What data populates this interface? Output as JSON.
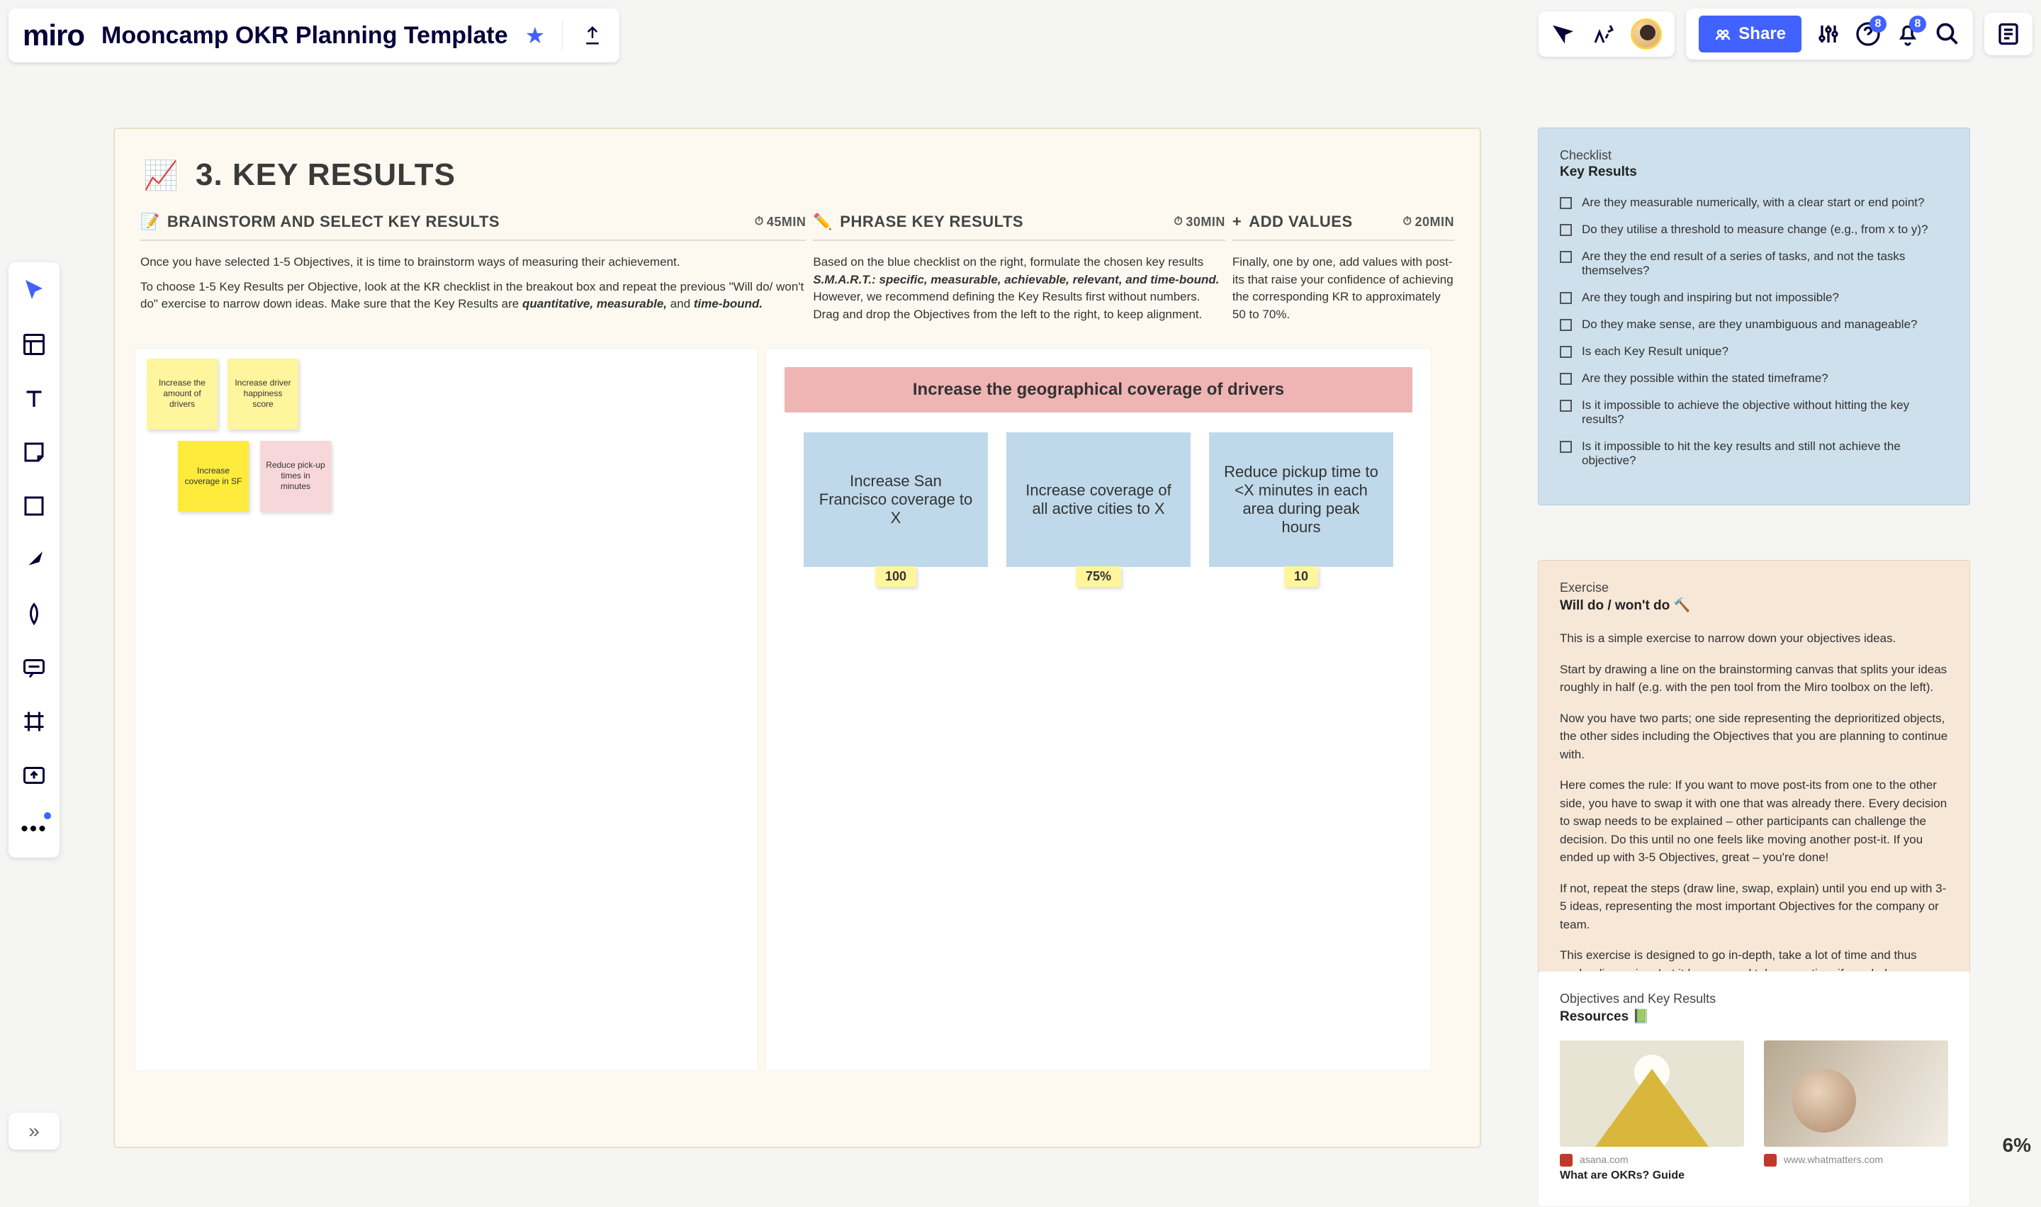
{
  "app": {
    "name": "miro"
  },
  "board": {
    "title": "Mooncamp OKR Planning Template"
  },
  "toolbar": {
    "share_label": "Share",
    "help_badge": "8",
    "bell_badge": "8"
  },
  "zoom": {
    "level": "6%"
  },
  "section": {
    "title_emoji": "📈",
    "title": "3. KEY RESULTS",
    "columns": [
      {
        "emoji": "📝",
        "heading": "BRAINSTORM AND SELECT KEY RESULTS",
        "time": "45min",
        "desc_p1": "Once you have selected 1-5 Objectives, it is time to brainstorm ways of measuring their achievement.",
        "desc_p2_a": "To choose 1-5 Key Results per Objective, look at the KR checklist in the breakout box and repeat the previous \"Will do/ won't do\" exercise to narrow down ideas. Make sure that the Key Results are ",
        "desc_p2_b": "quantitative, measurable,",
        "desc_p2_c": " and ",
        "desc_p2_d": "time-bound."
      },
      {
        "emoji": "✏️",
        "heading": "PHRASE KEY RESULTS",
        "time": "30min",
        "desc_p1_a": "Based on the blue checklist on the right, formulate the chosen key results ",
        "desc_p1_b": "S.M.A.R.T.: specific, measurable, achievable, relevant, and time-bound.",
        "desc_p1_c": " However, we recommend defining the Key Results first without numbers. Drag and drop the Objectives from the left to the right, to keep alignment."
      },
      {
        "emoji": "+",
        "heading": "ADD VALUES",
        "time": "20min",
        "desc": "Finally, one by one, add values with post-its that raise your confidence of achieving the corresponding KR to approximately 50 to 70%."
      }
    ]
  },
  "stickies": {
    "s1": "Increase the amount of drivers",
    "s2": "Increase driver happiness score",
    "s3": "Increase coverage in SF",
    "s4": "Reduce pick-up times in minutes"
  },
  "kr": {
    "strip": "Increase the geographical coverage of drivers",
    "cards": [
      {
        "text": "Increase San Francisco coverage to X",
        "value": "100"
      },
      {
        "text": "Increase coverage of all active cities to X",
        "value": "75%"
      },
      {
        "text": "Reduce pickup time to <X minutes in each area during peak hours",
        "value": "10"
      }
    ]
  },
  "checklist": {
    "label": "Checklist",
    "title": "Key Results",
    "items": [
      "Are they measurable numerically, with a clear start or end point?",
      "Do they utilise a threshold to measure change (e.g., from x to y)?",
      "Are they the end result of a series of tasks, and not the tasks themselves?",
      "Are they tough and inspiring but not impossible?",
      "Do they make sense, are they unambiguous and manageable?",
      "Is each Key Result unique?",
      "Are they possible within the stated timeframe?",
      "Is it impossible to achieve the objective without hitting the key results?",
      "Is it impossible to hit the key results and still not achieve the objective?"
    ]
  },
  "exercise": {
    "label": "Exercise",
    "title": "Will do / won't do 🔨",
    "p1": "This is a simple exercise to narrow down your objectives ideas.",
    "p2": "Start by drawing a line on the brainstorming canvas that splits your ideas roughly in half (e.g. with the pen tool from the Miro toolbox on the left).",
    "p3": "Now you have two parts; one side representing the deprioritized objects, the other sides including the Objectives that you are planning to continue with.",
    "p4": "Here comes the rule: If you want to move post-its from one to the other side, you have to swap it with one that was already there. Every decision to swap needs to be explained – other participants can challenge the decision. Do this until no one feels like moving another post-it. If you ended up with 3-5 Objectives, great – you're done!",
    "p5": "If not, repeat the steps (draw line, swap, explain) until you end up with 3-5 ideas, representing the most important Objectives for the company or team.",
    "p6": "This exercise is designed to go in-depth, take a lot of time and thus evoke discussion. Let it happen and take more time if needed."
  },
  "resources": {
    "label": "Objectives and Key Results",
    "title": "Resources 📗",
    "cards": [
      {
        "src": "asana.com",
        "title": "What are OKRs? Guide"
      },
      {
        "src": "www.whatmatters.com",
        "title": ""
      }
    ]
  }
}
